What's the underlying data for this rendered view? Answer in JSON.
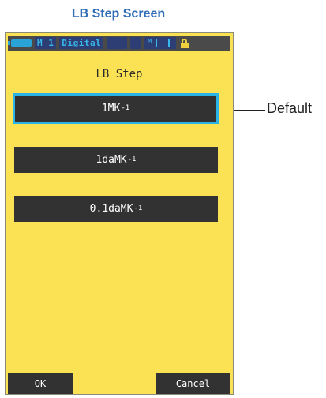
{
  "heading": "LB Step Screen",
  "status_bar": {
    "memory": "M 1",
    "mode": "Digital",
    "meter_marker": "M"
  },
  "screen": {
    "title": "LB Step",
    "options": [
      {
        "base": "1MK",
        "exp": "-1",
        "selected": true
      },
      {
        "base": "1daMK",
        "exp": "-1",
        "selected": false
      },
      {
        "base": "0.1daMK",
        "exp": "-1",
        "selected": false
      }
    ],
    "ok_label": "OK",
    "cancel_label": "Cancel"
  },
  "callout": "Default",
  "colors": {
    "screen_bg": "#fbe254",
    "button_bg": "#333232",
    "selected_border": "#2ab3e8",
    "heading": "#2f6db6"
  }
}
